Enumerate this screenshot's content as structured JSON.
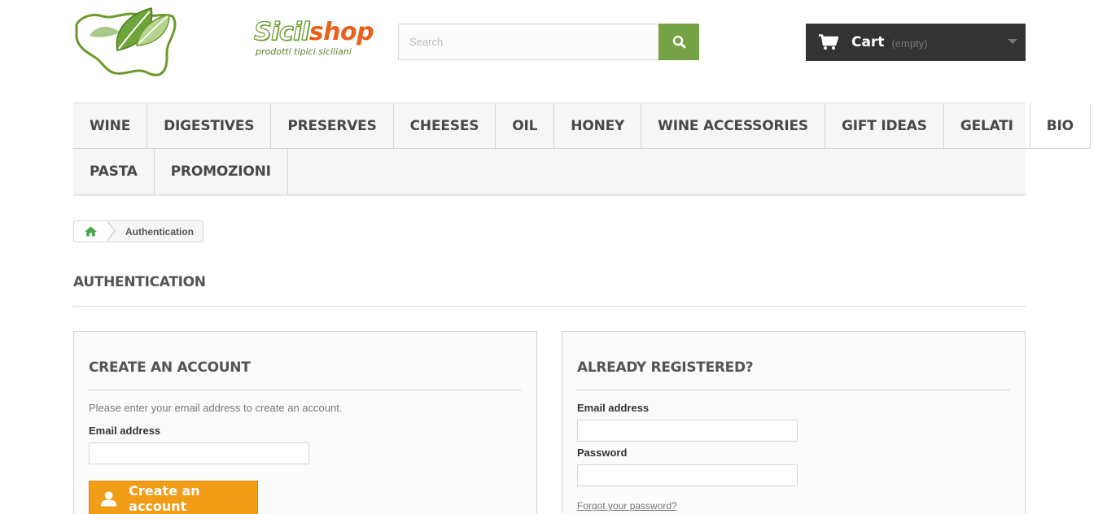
{
  "header": {
    "logo_brand_part1": "Sicil",
    "logo_brand_part2": "shop",
    "logo_tagline": "prodotti tipici siciliani",
    "search_placeholder": "Search",
    "cart_label": "Cart",
    "cart_status": "(empty)"
  },
  "menu": {
    "row1": [
      "WINE",
      "DIGESTIVES",
      "PRESERVES",
      "CHEESES",
      "OIL",
      "HONEY",
      "WINE ACCESSORIES",
      "GIFT IDEAS",
      "GELATI",
      "BIO"
    ],
    "row2": [
      "PASTA",
      "PROMOZIONI"
    ]
  },
  "breadcrumb": {
    "current": "Authentication"
  },
  "page": {
    "heading": "AUTHENTICATION"
  },
  "create_account": {
    "title": "CREATE AN ACCOUNT",
    "intro": "Please enter your email address to create an account.",
    "email_label": "Email address",
    "button_label": "Create an account"
  },
  "login": {
    "title": "ALREADY REGISTERED?",
    "email_label": "Email address",
    "password_label": "Password",
    "forgot_label": "Forgot your password?"
  },
  "colors": {
    "accent_green": "#75a244",
    "cart_bg": "#333333",
    "button_orange": "#f29d18",
    "logo_orange": "#e8601a"
  },
  "icons": {
    "search": "search-icon",
    "cart": "shopping-cart-icon",
    "home": "home-icon",
    "user": "user-icon",
    "caret": "caret-down-icon"
  }
}
